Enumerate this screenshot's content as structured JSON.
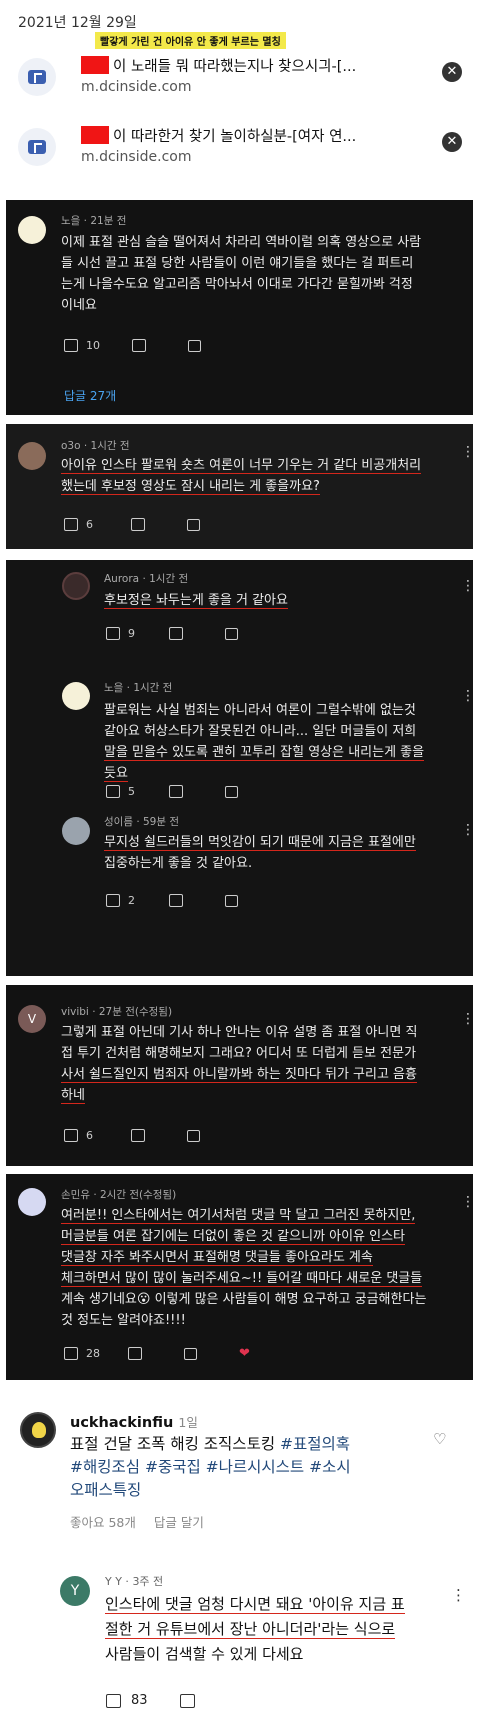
{
  "date": "2021년 12월 29일",
  "caption": "빨갛게 가린 건 아이유 안 좋게 부르는 멸칭",
  "results": [
    {
      "title": "이 노래들 뭐 따라했는지나 찾으시긔-[...",
      "url": "m.dcinside.com"
    },
    {
      "title": "이 따라한거 찾기 놀이하실분-[여자 연...",
      "url": "m.dcinside.com"
    }
  ],
  "comments": [
    {
      "author": "노을",
      "time": "21분 전",
      "lines": [
        "이제 표절 관심 슬슬 떨어져서 차라리 역바이럴 의혹 영상으로 사람",
        "들 시선 끌고 표절 당한 사람들이 이런 얘기들을 했다는 걸 퍼트리",
        "는게 나을수도요 알고리즘 막아놔서 이대로 가다간 묻힐까봐 걱정",
        "이네요"
      ],
      "likes": "10",
      "replies": "답글 27개"
    },
    {
      "author": "o3o",
      "time": "1시간 전",
      "lines": [
        "아이유 인스타 팔로워 숏츠 여론이 너무 기우는 거 같다 비공개처리",
        "했는데 후보정 영상도 잠시 내리는 게 좋을까요?"
      ],
      "likes": "6"
    },
    {
      "author": "Aurora",
      "time": "1시간 전",
      "lines": [
        "후보정은 놔두는게 좋을 거 같아요"
      ],
      "likes": "9"
    },
    {
      "author": "노을",
      "time": "1시간 전",
      "lines": [
        "팔로워는 사실 범죄는 아니라서 여론이 그럴수밖에 없는것",
        "같아요 허상스타가 잘못된건 아니라... 일단 머글들이 저희",
        "말을 믿을수 있도록 괜히 꼬투리 잡힐 영상은 내리는게 좋을",
        "듯요"
      ],
      "likes": "5"
    },
    {
      "author": "성이름",
      "time": "59분 전",
      "lines": [
        "무지성 쉴드러들의 먹잇감이 되기 때문에 지금은 표절에만",
        "집중하는게 좋을 것 같아요."
      ],
      "likes": "2"
    },
    {
      "author": "vivibi",
      "time": "27분 전(수정됨)",
      "lines": [
        "그렇게 표절 아닌데 기사 하나 안나는 이유 설명 좀 표절 아니면 직",
        "접 투기 건처럼 해명해보지 그래요? 어디서 또 더럽게 듣보 전문가",
        "사서 쉴드질인지 범죄자 아니랄까봐 하는 짓마다 뒤가 구리고 음흉",
        "하네"
      ],
      "likes": "6"
    },
    {
      "author": "손민유",
      "time": "2시간 전(수정됨)",
      "lines": [
        "여러분!! 인스타에서는 여기서처럼 댓글 막 달고 그러진 못하지만,",
        "머글분들 여론 잡기에는 더없이 좋은 것 같으니까 아이유 인스타",
        "댓글창 자주 봐주시면서 표절해명 댓글들 좋아요라도 계속",
        "체크하면서 많이 많이 눌러주세요~!! 들어갈 때마다 새로운 댓글들",
        "계속 생기네요😮 이렇게 많은 사람들이 해명 요구하고 궁금해한다는",
        "것 정도는 알려야죠!!!!"
      ],
      "likes": "28"
    }
  ],
  "ig_post": {
    "author": "uckhackinfiu",
    "time": "1일",
    "line1": "표절 건달 조폭 해킹 조직스토킹 ",
    "tag1": "#표절의혹",
    "line2": "#해킹조심 #중국집 #나르시시스트 #소시",
    "line3": "오패스특징",
    "likes": "좋아요 58개",
    "reply": "답글 달기"
  },
  "yt_reply": {
    "author": "Y Y",
    "time": "3주 전",
    "avatar": "Y",
    "lines": [
      "인스타에 댓글 엄청 다시면 돼요 '아이유 지금 표",
      "절한 거 유튜브에서 장난 아니더라'라는 식으로",
      "사람들이 검색할 수 있게 다세요"
    ],
    "likes": "83"
  }
}
